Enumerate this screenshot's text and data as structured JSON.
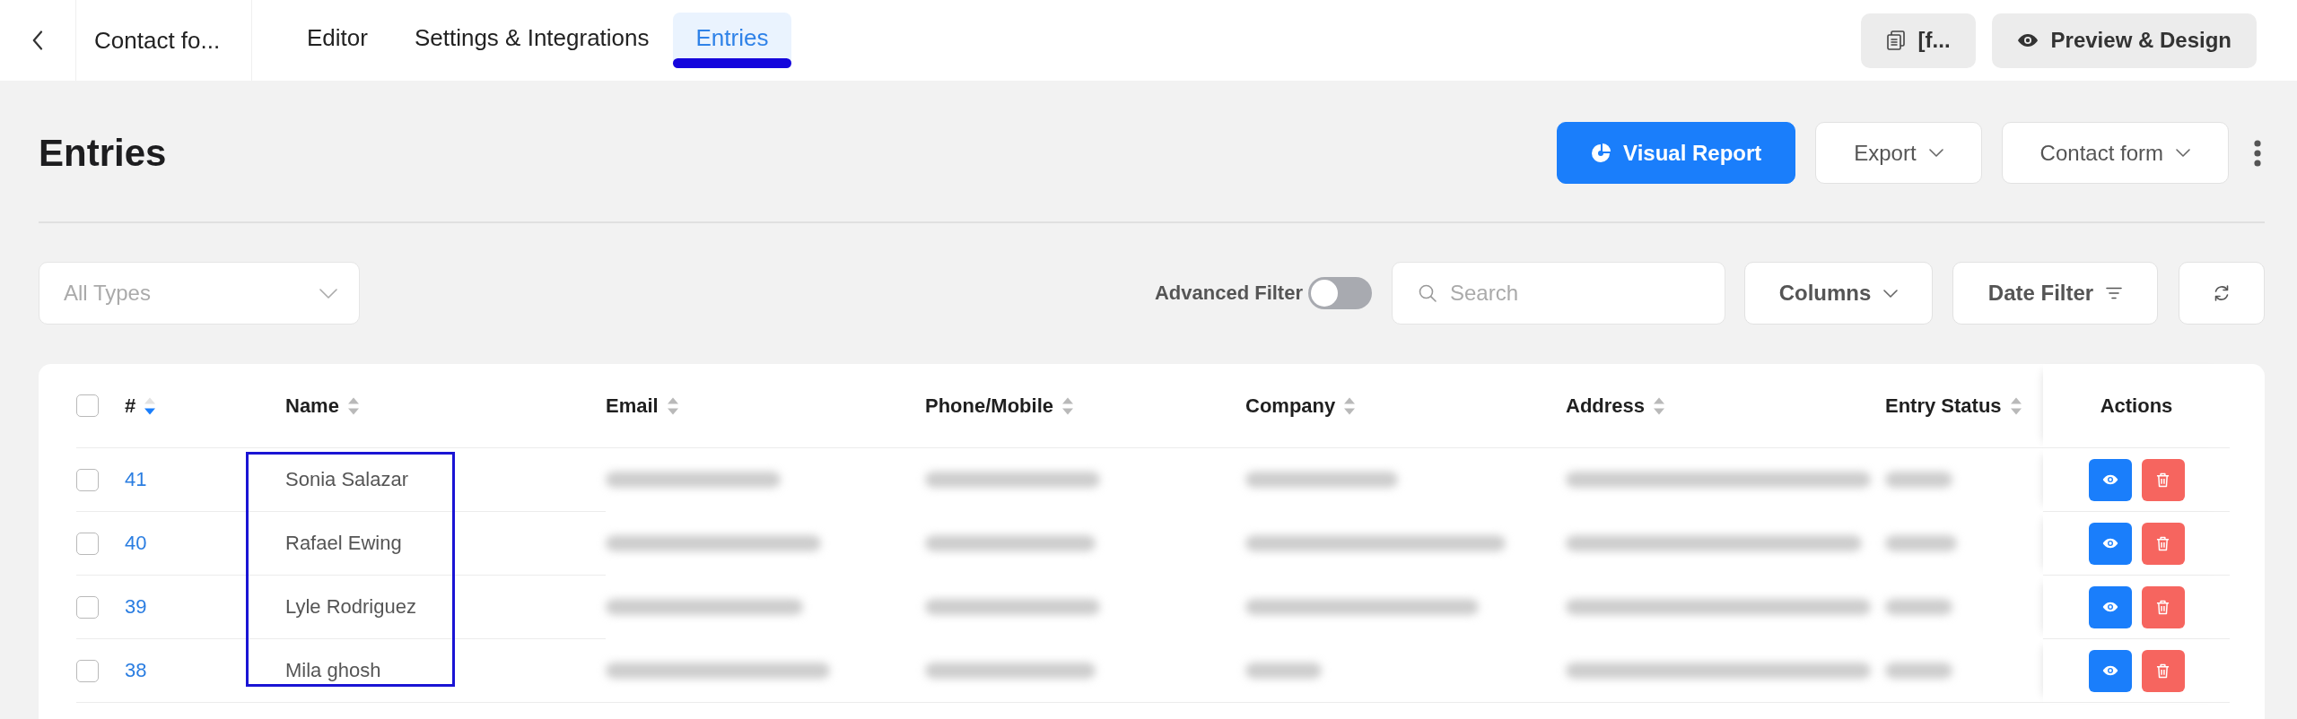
{
  "top_bar": {
    "form_title": "Contact fo...",
    "tabs": [
      {
        "label": "Editor",
        "selected": false
      },
      {
        "label": "Settings & Integrations",
        "selected": false
      },
      {
        "label": "Entries",
        "selected": true
      }
    ],
    "shortcode_button": "[f...",
    "preview_button": "Preview & Design"
  },
  "header": {
    "title": "Entries",
    "buttons": [
      {
        "label": "Visual Report",
        "kind": "primary"
      },
      {
        "label": "Export",
        "kind": "dropdown"
      },
      {
        "label": "Contact form",
        "kind": "dropdown"
      }
    ]
  },
  "filters": {
    "type_select": {
      "placeholder": "All Types"
    },
    "advanced_filter": {
      "label": "Advanced Filter",
      "on": false
    },
    "search": {
      "placeholder": "Search"
    },
    "columns_button": "Columns",
    "date_filter_button": "Date Filter"
  },
  "table": {
    "select_all": {
      "checked": false
    },
    "columns": [
      {
        "label": "#",
        "kind": "id",
        "sortable": true,
        "sorted": true,
        "highlighted": false
      },
      {
        "label": "Name",
        "kind": "name",
        "sortable": true,
        "sorted": false,
        "highlighted": true
      },
      {
        "label": "Email",
        "kind": "blurred",
        "sortable": true,
        "sorted": false,
        "highlighted": false
      },
      {
        "label": "Phone/Mobile",
        "kind": "blurred",
        "sortable": true,
        "sorted": false,
        "highlighted": false
      },
      {
        "label": "Company",
        "kind": "blurred",
        "sortable": true,
        "sorted": false,
        "highlighted": false
      },
      {
        "label": "Address",
        "kind": "blurred",
        "sortable": true,
        "sorted": false,
        "highlighted": false
      },
      {
        "label": "Entry Status",
        "kind": "blurred",
        "sortable": true,
        "sorted": false,
        "highlighted": false
      },
      {
        "label": "Actions",
        "kind": "actions",
        "sortable": false,
        "highlighted": false
      }
    ],
    "rows": [
      {
        "checked": false,
        "id": "41",
        "name": "Sonia Salazar"
      },
      {
        "checked": false,
        "id": "40",
        "name": "Rafael Ewing"
      },
      {
        "checked": false,
        "id": "39",
        "name": "Lyle Rodriguez"
      },
      {
        "checked": false,
        "id": "38",
        "name": "Mila ghosh"
      }
    ]
  }
}
